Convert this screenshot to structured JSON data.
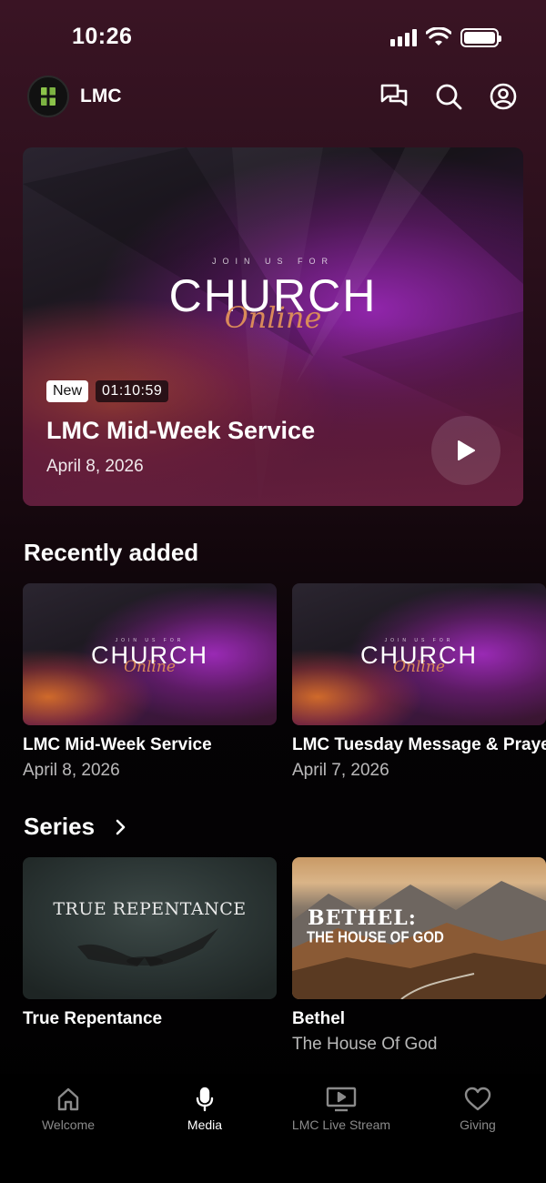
{
  "status_bar": {
    "time": "10:26"
  },
  "header": {
    "app_title": "LMC"
  },
  "hero": {
    "art_join": "JOIN US FOR",
    "art_church": "CHURCH",
    "art_online": "Online",
    "badge_new": "New",
    "duration": "01:10:59",
    "title": "LMC Mid-Week Service",
    "date": "April 8, 2026"
  },
  "recently_added": {
    "title": "Recently added",
    "items": [
      {
        "title": "LMC Mid-Week Service",
        "date": "April 8, 2026",
        "art_join": "JOIN US FOR",
        "art_church": "CHURCH",
        "art_online": "Online"
      },
      {
        "title": "LMC Tuesday Message & Prayer",
        "date": "April 7, 2026",
        "art_join": "JOIN US FOR",
        "art_church": "CHURCH",
        "art_online": "Online"
      }
    ]
  },
  "series": {
    "title": "Series",
    "items": [
      {
        "title": "True Repentance",
        "art_text": "TRUE REPENTANCE"
      },
      {
        "title": "Bethel",
        "subtitle": "The House Of God",
        "art_title": "BETHEL:",
        "art_subtitle": "THE HOUSE OF GOD"
      }
    ]
  },
  "bottom_nav": {
    "items": [
      {
        "label": "Welcome",
        "icon": "home-icon"
      },
      {
        "label": "Media",
        "icon": "microphone-icon",
        "active": true
      },
      {
        "label": "LMC Live Stream",
        "icon": "tv-play-icon"
      },
      {
        "label": "Giving",
        "icon": "heart-icon"
      }
    ]
  }
}
